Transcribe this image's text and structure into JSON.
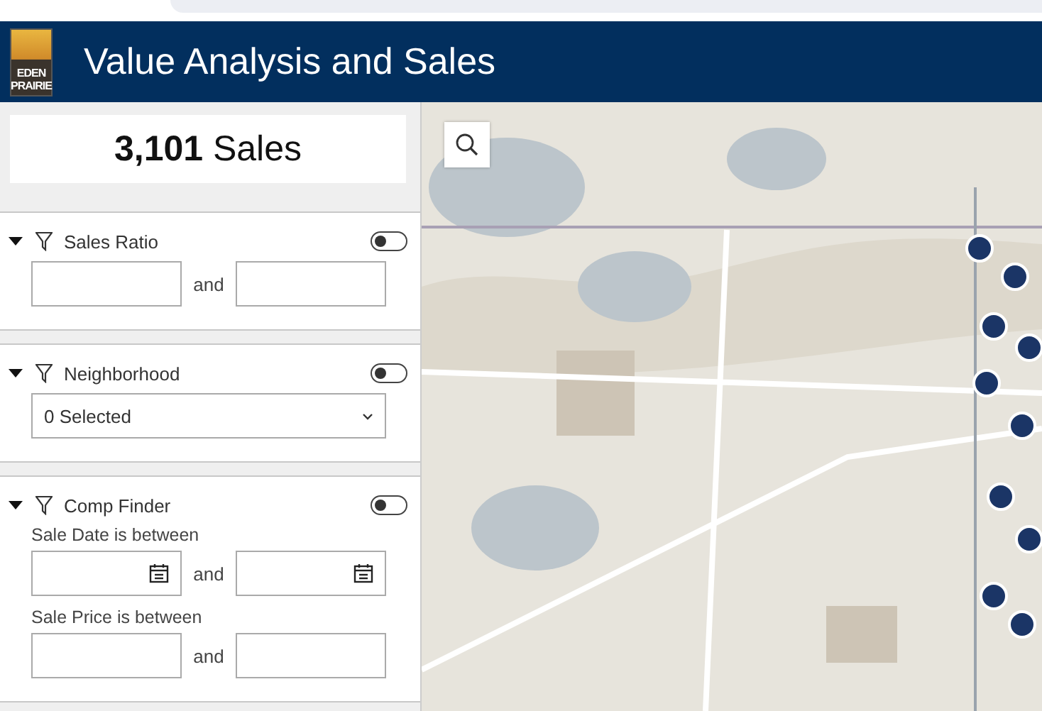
{
  "header": {
    "logo": "EDEN PRAIRIE",
    "title": "Value Analysis and Sales"
  },
  "summary": {
    "text": "**3,101** Sales"
  },
  "filters": [
    {
      "kind": "range",
      "title": "Sales Ratio",
      "expanded": true,
      "on": false,
      "connector": "and"
    },
    {
      "kind": "select",
      "title": "Neighborhood",
      "expanded": true,
      "on": false,
      "value": "0 Selected"
    },
    {
      "kind": "groups",
      "title": "Comp Finder",
      "expanded": true,
      "on": false,
      "rows": [
        {
          "kind": "date",
          "label": "Sale Date is between",
          "connector": "and"
        },
        {
          "kind": "text",
          "label": "Sale Price is between",
          "connector": "and"
        }
      ]
    }
  ]
}
